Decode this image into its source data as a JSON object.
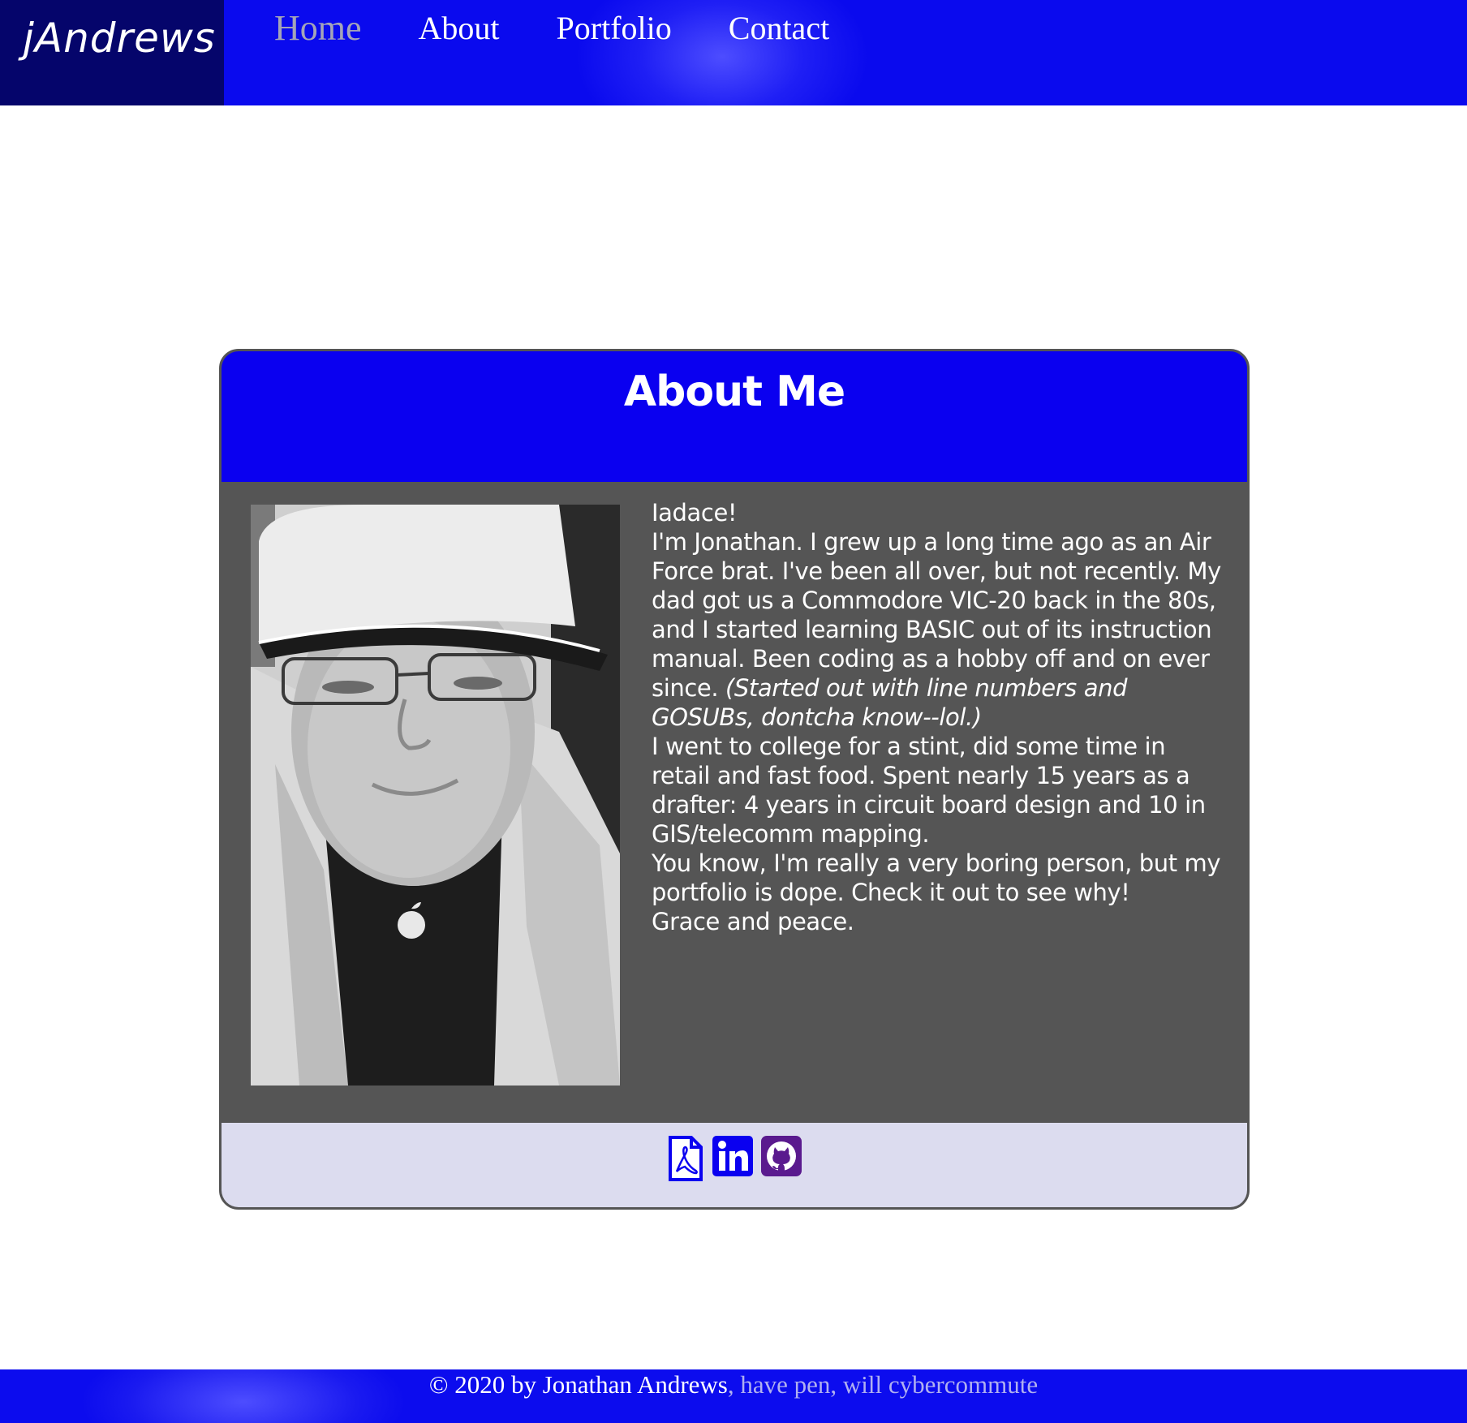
{
  "header": {
    "logo_text": "jAndrews",
    "nav": [
      {
        "label": "Home",
        "active": true
      },
      {
        "label": "About",
        "active": false
      },
      {
        "label": "Portfolio",
        "active": false
      },
      {
        "label": "Contact",
        "active": false
      }
    ]
  },
  "card": {
    "title": "About Me",
    "photo_icon": "profile-photo",
    "bio": {
      "greeting": "Iadace!",
      "p1_text": "I'm Jonathan. I grew up a long time ago as an Air Force brat. I've been all over, but not recently. My dad got us a Commodore VIC-20 back in the 80s, and I started learning BASIC out of its instruction manual. Been coding as a hobby off and on ever since. ",
      "p1_italic": "(Started out with line numbers and GOSUBs, dontcha know--lol.)",
      "p2": "I went to college for a stint, did some time in retail and fast food. Spent nearly 15 years as a drafter: 4 years in circuit board design and 10 in GIS/telecomm mapping.",
      "p3": "You know, I'm really a very boring person, but my portfolio is dope. Check it out to see why!",
      "p4": "Grace and peace."
    },
    "social_links": [
      {
        "icon": "pdf-resume-icon",
        "color": "#0a00f0"
      },
      {
        "icon": "linkedin-icon",
        "color": "#0a00f0"
      },
      {
        "icon": "github-icon",
        "color": "#5a1a8e"
      }
    ]
  },
  "footer": {
    "copyright": "© 2020 by Jonathan Andrews",
    "tagline": ", have pen, will cybercommute"
  },
  "colors": {
    "header_blue": "#0a0aee",
    "logo_bg": "#05056b",
    "card_header": "#0a00f0",
    "card_body": "#555555",
    "card_footer": "#dcdcef"
  }
}
